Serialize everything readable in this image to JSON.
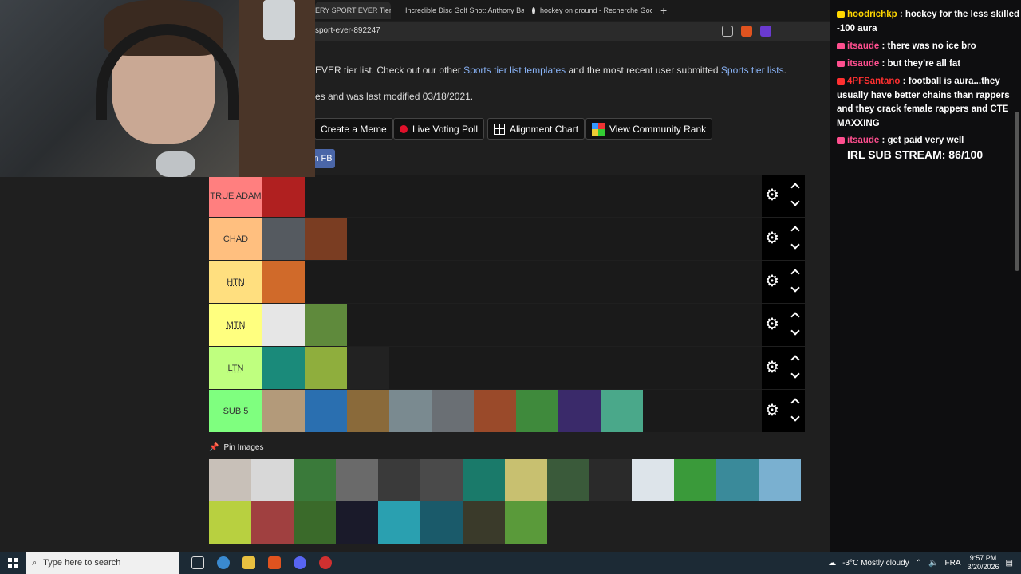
{
  "browser": {
    "tabs": [
      {
        "label": "ERY SPORT EVER Tier",
        "active": true
      },
      {
        "label": "Incredible Disc Golf Shot: Anthony Ba"
      },
      {
        "label": "hockey on ground - Recherche Goog"
      }
    ],
    "new_tab": "+",
    "url": "sport-ever-892247"
  },
  "page": {
    "intro": {
      "before": "EVER tier list. Check out our other ",
      "link1": "Sports tier list templates",
      "middle": " and the most recent user submitted ",
      "link2": "Sports tier lists",
      "after": "."
    },
    "modified": "es and was last modified 03/18/2021.",
    "buttons": {
      "meme": "Create a Meme",
      "vote": "Live Voting Poll",
      "alignment": "Alignment Chart",
      "community": "View Community Rank",
      "fb": "n FB"
    },
    "tiers": [
      {
        "label": "TRUE ADAM",
        "color": "#ff7f7f",
        "items": [
          "#b02020"
        ]
      },
      {
        "label": "CHAD",
        "color": "#ffbf7f",
        "items": [
          "#555a60",
          "#7a3d22"
        ]
      },
      {
        "label": "HTN",
        "color": "#ffdf7f",
        "items": [
          "#d06a2a"
        ]
      },
      {
        "label": "MTN",
        "color": "#ffff7f",
        "items": [
          "#e6e6e6",
          "#5f8a3c"
        ]
      },
      {
        "label": "LTN",
        "color": "#bfff7f",
        "items": [
          "#1a8a7a",
          "#8fae3d",
          "#222222"
        ]
      },
      {
        "label": "SUB 5",
        "color": "#7fff7f",
        "items": [
          "#b39a7a",
          "#2a6fb0",
          "#8a6a3a",
          "#7a8a90",
          "#6a6f74",
          "#9a4a2a",
          "#3f8a3c",
          "#3a2a6a",
          "#4aa88a"
        ]
      }
    ],
    "pin_label": "Pin Images",
    "pool": [
      "#c8c0b8",
      "#d8d8d8",
      "#3a7a3a",
      "#6a6a6a",
      "#3a3a3a",
      "#4a4a4a",
      "#1a7a6a",
      "#c8c070",
      "#3a5a3a",
      "#2a2a2a",
      "#dde4ea",
      "#3a9a3a",
      "#3a8a9a",
      "#7ab0d0",
      "#b8d040",
      "#a04040",
      "#3a6a2a",
      "#1a1a2a",
      "#2aa0b0",
      "#1a5a6a",
      "#3a3a2a",
      "#5a9a3a"
    ]
  },
  "chat": {
    "messages": [
      {
        "user": "hoodrichkp",
        "color": "#ffd700",
        "text": " : hockey for the less skilled -100 aura"
      },
      {
        "user": "itsaude",
        "color": "#ff4f8f",
        "text": " : there was no ice bro"
      },
      {
        "user": "itsaude",
        "color": "#ff4f8f",
        "text": " : but they're all fat"
      },
      {
        "user": "4PFSantano",
        "color": "#ff3030",
        "text": " : football is aura...they usually have better chains than rappers and they crack female rappers and CTE MAXXING"
      },
      {
        "user": "itsaude",
        "color": "#ff4f8f",
        "text": " : get paid very well"
      }
    ],
    "sub_stream": "IRL SUB STREAM: 86/100"
  },
  "taskbar": {
    "search_placeholder": "Type here to search",
    "weather": "-3°C  Mostly cloudy",
    "lang": "FRA",
    "time": "9:57 PM",
    "date": "3/20/2026"
  }
}
